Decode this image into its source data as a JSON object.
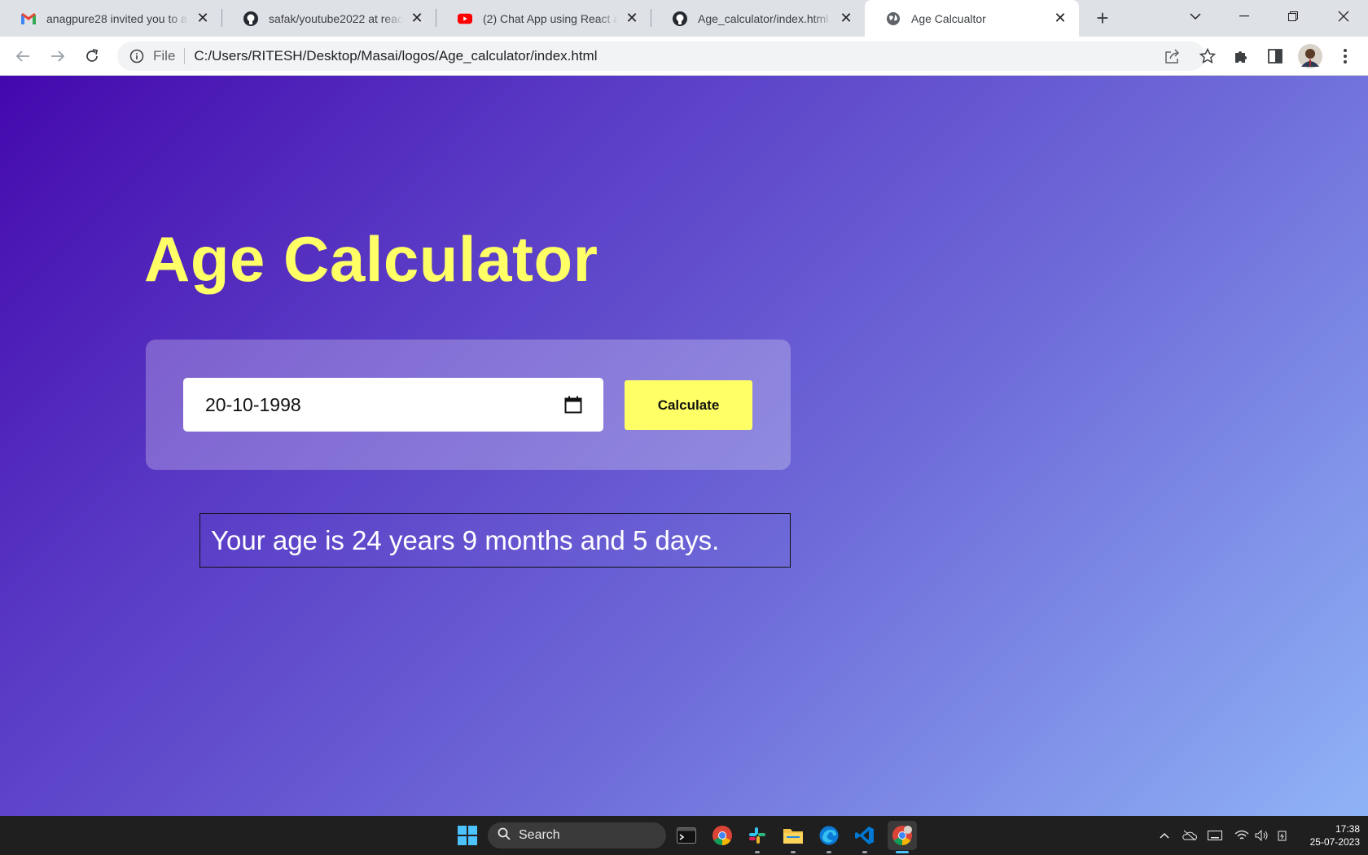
{
  "browser": {
    "tabs": [
      {
        "title": "anagpure28 invited you to a",
        "favicon": "gmail-icon"
      },
      {
        "title": "safak/youtube2022 at react-",
        "favicon": "github-icon"
      },
      {
        "title": "(2) Chat App using React an",
        "favicon": "youtube-icon"
      },
      {
        "title": "Age_calculator/index.html a",
        "favicon": "github-icon"
      },
      {
        "title": "Age Calcualtor",
        "favicon": "globe-icon",
        "active": true
      }
    ],
    "omnibox": {
      "scheme_label": "File",
      "url": "C:/Users/RITESH/Desktop/Masai/logos/Age_calculator/index.html"
    }
  },
  "page": {
    "heading": "Age Calculator",
    "date_value": "20-10-1998",
    "calculate_label": "Calculate",
    "result": "Your age is 24 years 9 months and 5 days."
  },
  "taskbar": {
    "search_label": "Search",
    "time": "17:38",
    "date": "25-07-2023"
  },
  "colors": {
    "heading": "#ffff66",
    "button": "#ffff66",
    "gradient_start": "#4408ad",
    "gradient_end": "#8fb3f6"
  }
}
